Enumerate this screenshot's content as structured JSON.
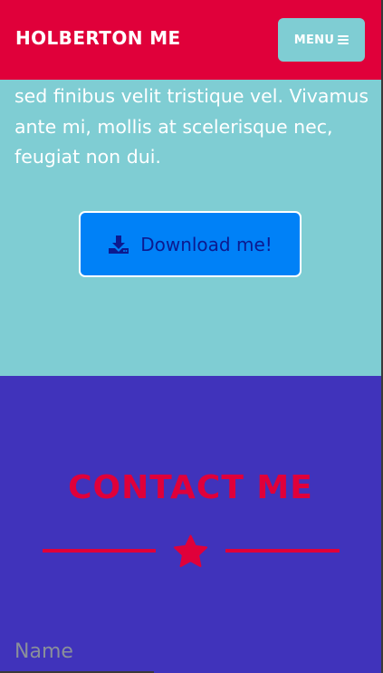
{
  "navbar": {
    "brand": "HOLBERTON ME",
    "menu_label": "MENU",
    "menu_icon": "bars-icon"
  },
  "about": {
    "text": "sed finibus velit tristique vel. Vivamus ante mi, mollis at scelerisque nec, feugiat non dui.",
    "download_label": "Download me!",
    "download_icon": "download-icon"
  },
  "contact": {
    "title": "CONTACT ME",
    "divider_icon": "star-icon",
    "name_placeholder": "Name"
  },
  "colors": {
    "header": "#e0003a",
    "teal": "#7fcdd3",
    "purple": "#4033bb",
    "button_blue": "#0081f7",
    "accent_red": "#e0003a"
  }
}
